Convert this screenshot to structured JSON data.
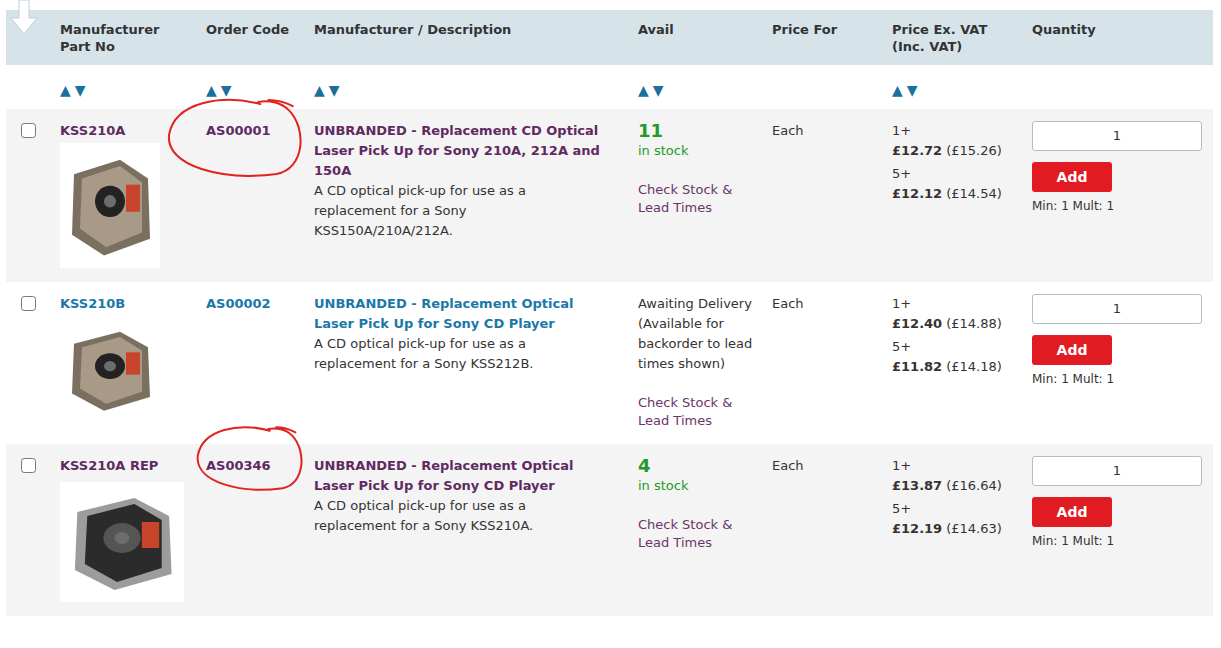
{
  "table": {
    "columns": [
      {
        "label": "Manufacturer Part No",
        "sortable": true,
        "sort_up": "▲",
        "sort_down": "▼"
      },
      {
        "label": "Order Code",
        "sortable": true,
        "sort_up": "▲",
        "sort_down": "▼"
      },
      {
        "label": "Manufacturer / Description",
        "sortable": true,
        "sort_up": "▲",
        "sort_down": "▼"
      },
      {
        "label": "Avail",
        "sortable": true,
        "sort_up": "▲",
        "sort_down": "▼"
      },
      {
        "label": "Price For",
        "sortable": false
      },
      {
        "label": "Price Ex. VAT (Inc. VAT)",
        "sortable": true,
        "sort_up": "▲",
        "sort_down": "▼"
      },
      {
        "label": "Quantity",
        "sortable": false
      }
    ],
    "rows": [
      {
        "selected": false,
        "visited": true,
        "circled": true,
        "part_no": "KSS210A",
        "order_code": "AS00001",
        "title": "UNBRANDED - Replacement CD Optical Laser Pick Up for Sony 210A, 212A and 150A",
        "description": "A CD optical pick-up for use as a replacement for a Sony KSS150A/210A/212A.",
        "avail": {
          "kind": "in-stock",
          "count": "11",
          "label": "in stock"
        },
        "check_stock": "Check Stock & Lead Times",
        "price_for": "Each",
        "price_breaks": [
          {
            "qty": "1+",
            "ex": "£12.72",
            "inc": "(£15.26)"
          },
          {
            "qty": "5+",
            "ex": "£12.12",
            "inc": "(£14.54)"
          }
        ],
        "quantity": "1",
        "add_label": "Add",
        "min_mult": "Min: 1 Mult: 1"
      },
      {
        "selected": false,
        "visited": false,
        "circled": false,
        "part_no": "KSS210B",
        "order_code": "AS00002",
        "title": "UNBRANDED - Replacement Optical Laser Pick Up for Sony CD Player",
        "description": "A CD optical pick-up for use as a replacement for a Sony KSS212B.",
        "avail": {
          "kind": "backorder",
          "text": "Awaiting Delivery (Available for backorder to lead times shown)"
        },
        "check_stock": "Check Stock & Lead Times",
        "price_for": "Each",
        "price_breaks": [
          {
            "qty": "1+",
            "ex": "£12.40",
            "inc": "(£14.88)"
          },
          {
            "qty": "5+",
            "ex": "£11.82",
            "inc": "(£14.18)"
          }
        ],
        "quantity": "1",
        "add_label": "Add",
        "min_mult": "Min: 1 Mult: 1"
      },
      {
        "selected": false,
        "visited": true,
        "circled": true,
        "part_no": "KSS210A REP",
        "order_code": "AS00346",
        "title": "UNBRANDED - Replacement Optical Laser Pick Up for Sony CD Player",
        "description": "A CD optical pick-up for use as a replacement for a Sony KSS210A.",
        "avail": {
          "kind": "in-stock",
          "count": "4",
          "label": "in stock"
        },
        "check_stock": "Check Stock & Lead Times",
        "price_for": "Each",
        "price_breaks": [
          {
            "qty": "1+",
            "ex": "£13.87",
            "inc": "(£16.64)"
          },
          {
            "qty": "5+",
            "ex": "£12.19",
            "inc": "(£14.63)"
          }
        ],
        "quantity": "1",
        "add_label": "Add",
        "min_mult": "Min: 1 Mult: 1"
      }
    ]
  }
}
